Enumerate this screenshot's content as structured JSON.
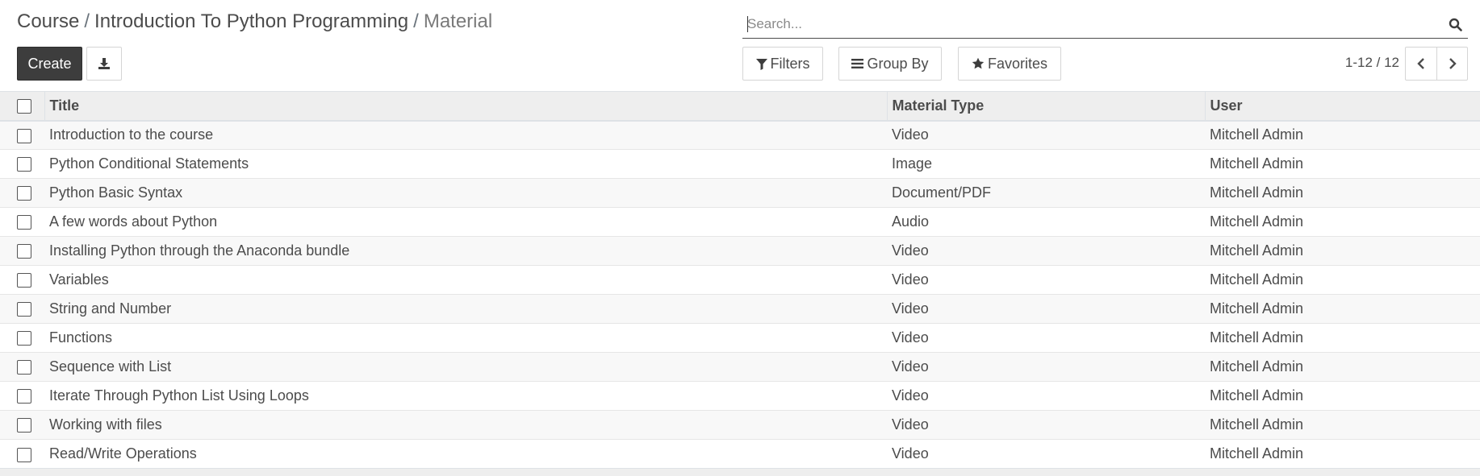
{
  "breadcrumb": {
    "items": [
      "Course",
      "Introduction To Python Programming"
    ],
    "separator": "/",
    "current": "Material"
  },
  "toolbar": {
    "create_label": "Create",
    "download_icon": "download-icon"
  },
  "search": {
    "placeholder": "Search...",
    "value": "",
    "icon": "search-icon"
  },
  "filters": {
    "filters_label": "Filters",
    "groupby_label": "Group By",
    "favorites_label": "Favorites"
  },
  "pager": {
    "value": "1-12 / 12"
  },
  "table": {
    "columns": [
      "Title",
      "Material Type",
      "User"
    ],
    "rows": [
      {
        "title": "Introduction to the course",
        "type": "Video",
        "user": "Mitchell Admin"
      },
      {
        "title": "Python Conditional Statements",
        "type": "Image",
        "user": "Mitchell Admin"
      },
      {
        "title": "Python Basic Syntax",
        "type": "Document/PDF",
        "user": "Mitchell Admin"
      },
      {
        "title": "A few words about Python",
        "type": "Audio",
        "user": "Mitchell Admin"
      },
      {
        "title": "Installing Python through the Anaconda bundle",
        "type": "Video",
        "user": "Mitchell Admin"
      },
      {
        "title": "Variables",
        "type": "Video",
        "user": "Mitchell Admin"
      },
      {
        "title": "String and Number",
        "type": "Video",
        "user": "Mitchell Admin"
      },
      {
        "title": "Functions",
        "type": "Video",
        "user": "Mitchell Admin"
      },
      {
        "title": "Sequence with List",
        "type": "Video",
        "user": "Mitchell Admin"
      },
      {
        "title": "Iterate Through Python List Using Loops",
        "type": "Video",
        "user": "Mitchell Admin"
      },
      {
        "title": "Working with files",
        "type": "Video",
        "user": "Mitchell Admin"
      },
      {
        "title": "Read/Write Operations",
        "type": "Video",
        "user": "Mitchell Admin"
      }
    ]
  },
  "colors": {
    "primary_dark": "#3d3d3d",
    "text": "#4c4c4c",
    "header_bg": "#eeeeee",
    "row_stripe": "#f8f8f8"
  }
}
